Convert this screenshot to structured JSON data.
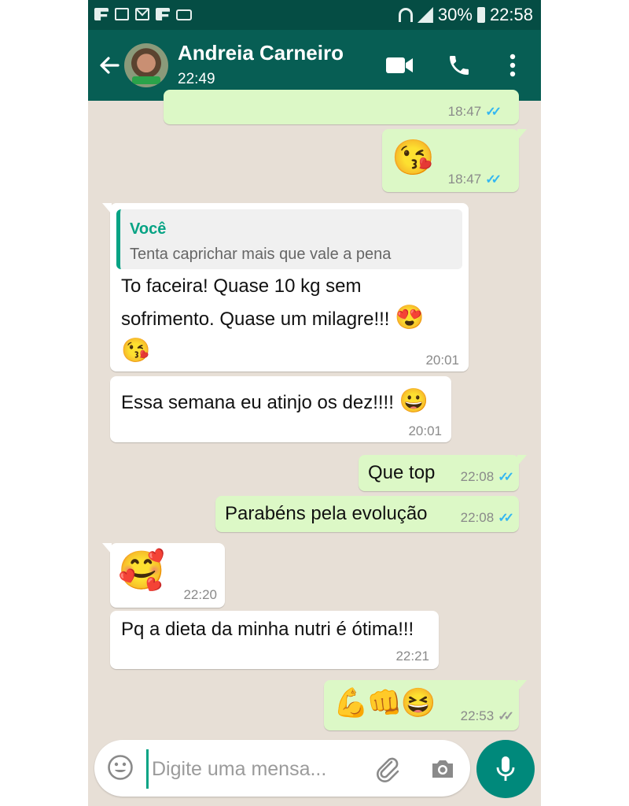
{
  "status_bar": {
    "battery_percent": "30%",
    "time": "22:58"
  },
  "header": {
    "contact_name": "Andreia Carneiro",
    "last_seen": "22:49"
  },
  "messages": [
    {
      "direction": "out",
      "text": "",
      "time": "18:47",
      "ticks": "blue"
    },
    {
      "direction": "out",
      "text": "😘",
      "time": "18:47",
      "ticks": "blue"
    },
    {
      "direction": "in",
      "quote_author": "Você",
      "quote_text": "Tenta caprichar mais que vale a pena",
      "line1": "To faceira! Quase 10 kg sem",
      "line2": "sofrimento. Quase um milagre!!!",
      "time": "20:01"
    },
    {
      "direction": "in",
      "text": "Essa semana eu atinjo os dez!!!!",
      "time": "20:01"
    },
    {
      "direction": "out",
      "text": "Que top",
      "time": "22:08",
      "ticks": "blue"
    },
    {
      "direction": "out",
      "text": "Parabéns pela evolução",
      "time": "22:08",
      "ticks": "blue"
    },
    {
      "direction": "in",
      "text": "🥰",
      "time": "22:20"
    },
    {
      "direction": "in",
      "text": "Pq a dieta da minha nutri é ótima!!!",
      "time": "22:21"
    },
    {
      "direction": "out",
      "text": "💪👊😆",
      "time": "22:53",
      "ticks": "grey"
    }
  ],
  "composer": {
    "placeholder": "Digite uma mensa..."
  },
  "colors": {
    "header": "#075e54",
    "statusbar": "#054d44",
    "outgoing": "#dcf8c6",
    "incoming": "#ffffff",
    "chat_bg": "#e7dfd6",
    "accent": "#00897b",
    "read_ticks": "#34b7f1"
  },
  "icons": [
    "back-arrow-icon",
    "video-call-icon",
    "phone-icon",
    "more-options-icon",
    "emoji-icon",
    "attach-icon",
    "camera-icon",
    "mic-icon"
  ]
}
